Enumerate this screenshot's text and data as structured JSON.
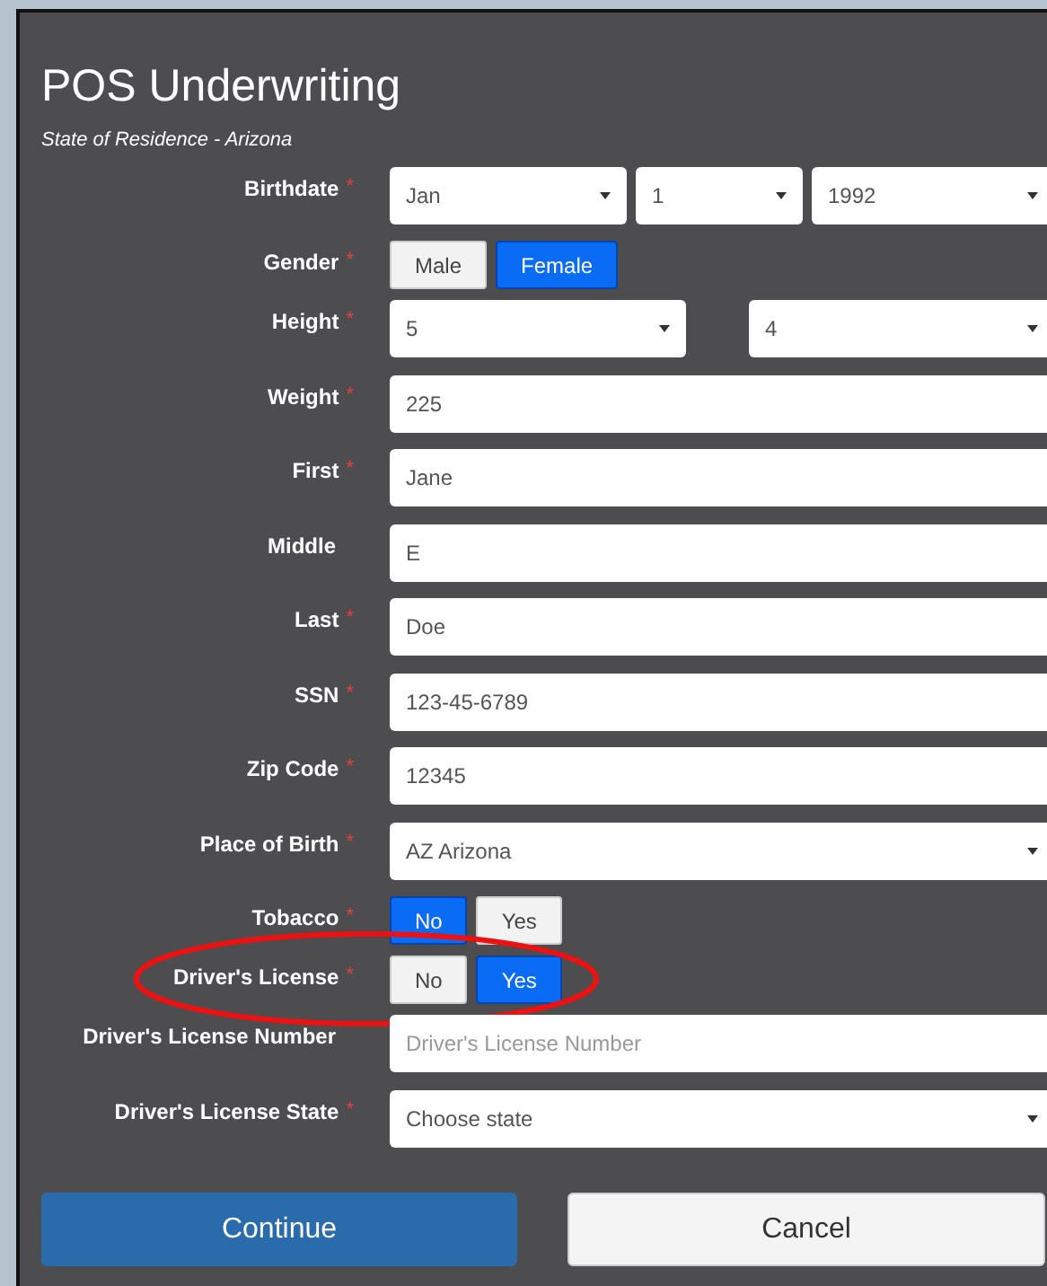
{
  "title": "POS Underwriting",
  "subtitle": "State of Residence - Arizona",
  "fields": [
    {
      "kind": "selects",
      "label": "Birthdate",
      "required_mark": "*",
      "selects": [
        {
          "value": "Jan"
        },
        {
          "value": "1"
        },
        {
          "value": "1992"
        }
      ]
    },
    {
      "kind": "toggle",
      "label": "Gender",
      "required_mark": "*",
      "options": [
        {
          "label": "Male",
          "selected": false
        },
        {
          "label": "Female",
          "selected": true
        }
      ]
    },
    {
      "kind": "selects",
      "label": "Height",
      "required_mark": "*",
      "selects": [
        {
          "value": "5"
        },
        {
          "value": "4"
        }
      ]
    },
    {
      "kind": "text",
      "label": "Weight",
      "required_mark": "*",
      "value": "225"
    },
    {
      "kind": "text",
      "label": "First",
      "required_mark": "*",
      "value": "Jane"
    },
    {
      "kind": "text",
      "label": "Middle",
      "value": "E"
    },
    {
      "kind": "text",
      "label": "Last",
      "required_mark": "*",
      "value": "Doe"
    },
    {
      "kind": "text",
      "label": "SSN",
      "required_mark": "*",
      "value": "123-45-6789"
    },
    {
      "kind": "text",
      "label": "Zip Code",
      "required_mark": "*",
      "value": "12345"
    },
    {
      "kind": "select",
      "label": "Place of Birth",
      "required_mark": "*",
      "value": "AZ Arizona"
    },
    {
      "kind": "toggle",
      "label": "Tobacco",
      "required_mark": "*",
      "options": [
        {
          "label": "No",
          "selected": true
        },
        {
          "label": "Yes",
          "selected": false
        }
      ]
    },
    {
      "kind": "toggle",
      "label": "Driver's License",
      "required_mark": "*",
      "circled": true,
      "options": [
        {
          "label": "No",
          "selected": false
        },
        {
          "label": "Yes",
          "selected": true
        }
      ]
    },
    {
      "kind": "text",
      "label": "Driver's License Number",
      "placeholder": "Driver's License Number"
    },
    {
      "kind": "select",
      "label": "Driver's License State",
      "required_mark": "*",
      "value": "Choose state"
    }
  ],
  "buttons": [
    {
      "kind": "primary",
      "label": "Continue"
    },
    {
      "kind": "secondary",
      "label": "Cancel"
    }
  ]
}
